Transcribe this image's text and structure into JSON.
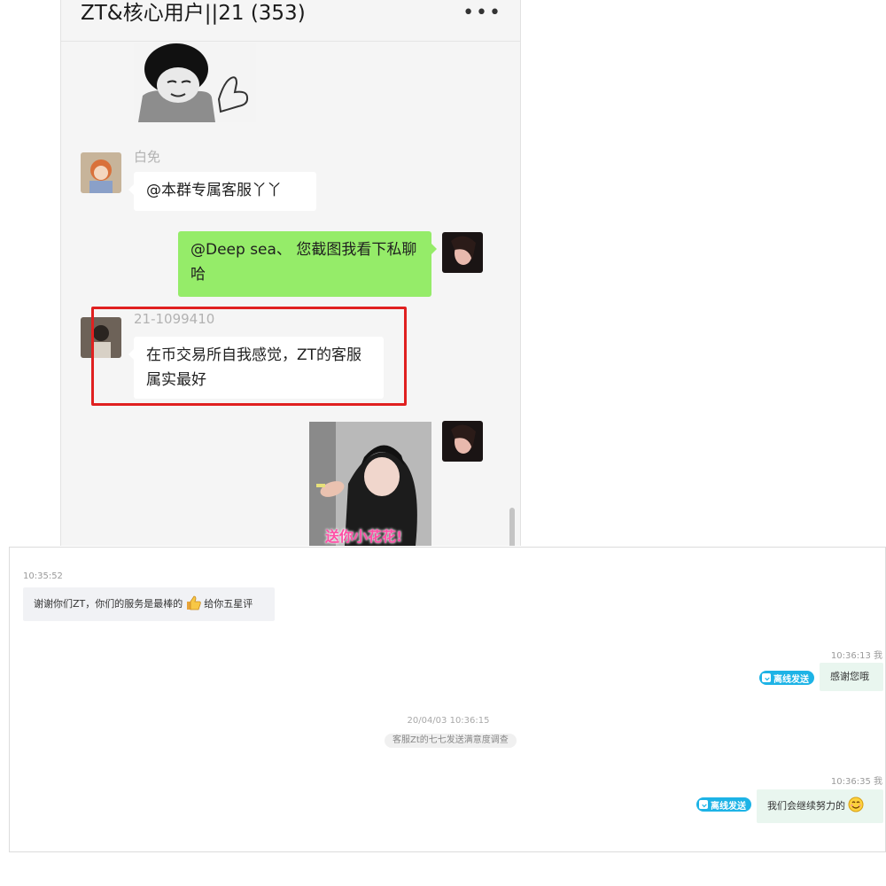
{
  "group_chat": {
    "title": "ZT&核心用户||21 (353)",
    "more_icon": "•••",
    "messages": [
      {
        "sender": "白免",
        "text": "@本群专属客服丫丫"
      },
      {
        "sender": "me",
        "text": "@Deep sea、 您截图我看下私聊哈"
      },
      {
        "sender": "21-1099410",
        "text": "在币交易所自我感觉，ZT的客服属实最好"
      }
    ],
    "sticker_label": "送你小花花!"
  },
  "service_log": {
    "msg1": {
      "time": "10:35:52",
      "text": "谢谢你们ZT，你们的服务是最棒的",
      "text_after": "给你五星评",
      "emoji": "thumbs-up"
    },
    "msg2": {
      "time": "10:36:13 我",
      "badge": "离线发送",
      "text": "感谢您哦"
    },
    "system": {
      "date": "20/04/03 10:36:15",
      "notice": "客服Zt的七七发送满意度调查"
    },
    "msg3": {
      "time": "10:36:35 我",
      "badge": "离线发送",
      "text": "我们会继续努力的",
      "emoji": "smile"
    }
  },
  "colors": {
    "accent_green": "#95ec69",
    "highlight_red": "#e02020",
    "badge_blue": "#1db3e6"
  }
}
